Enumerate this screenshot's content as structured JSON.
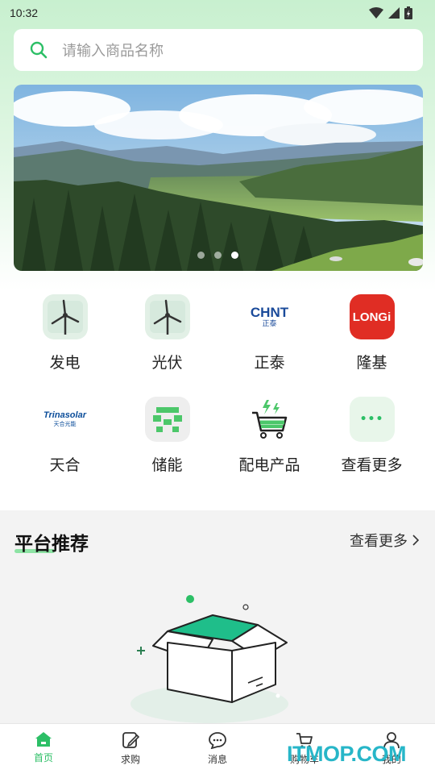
{
  "status_bar": {
    "time": "10:32"
  },
  "search": {
    "placeholder": "请输入商品名称"
  },
  "banner": {
    "slide_count": 3,
    "active_slide": 3
  },
  "categories": [
    {
      "label": "发电",
      "icon": "wind-turbine-icon"
    },
    {
      "label": "光伏",
      "icon": "wind-turbine-icon"
    },
    {
      "label": "正泰",
      "icon": "chint-logo",
      "logo_text": "CHNT",
      "logo_sub": "正泰"
    },
    {
      "label": "隆基",
      "icon": "longi-logo",
      "logo_text": "LONGi"
    },
    {
      "label": "天合",
      "icon": "trinasolar-logo",
      "logo_text": "Trinasolar",
      "logo_sub": "天合光能"
    },
    {
      "label": "储能",
      "icon": "storage-icon"
    },
    {
      "label": "配电产品",
      "icon": "shopping-cart-icon"
    },
    {
      "label": "查看更多",
      "icon": "more-icon",
      "logo_text": "•••"
    }
  ],
  "recommend": {
    "title": "平台推荐",
    "more_label": "查看更多"
  },
  "tabbar": [
    {
      "label": "首页",
      "icon": "home-icon",
      "active": true
    },
    {
      "label": "求购",
      "icon": "edit-icon",
      "active": false
    },
    {
      "label": "消息",
      "icon": "message-icon",
      "active": false
    },
    {
      "label": "购物车",
      "icon": "cart-icon",
      "active": false
    },
    {
      "label": "我的",
      "icon": "user-icon",
      "active": false
    }
  ],
  "watermark": {
    "text": "ITMOP.COM"
  },
  "colors": {
    "accent": "#2cbf66",
    "longi_red": "#e02d24",
    "chint_blue": "#1a4a9a"
  }
}
